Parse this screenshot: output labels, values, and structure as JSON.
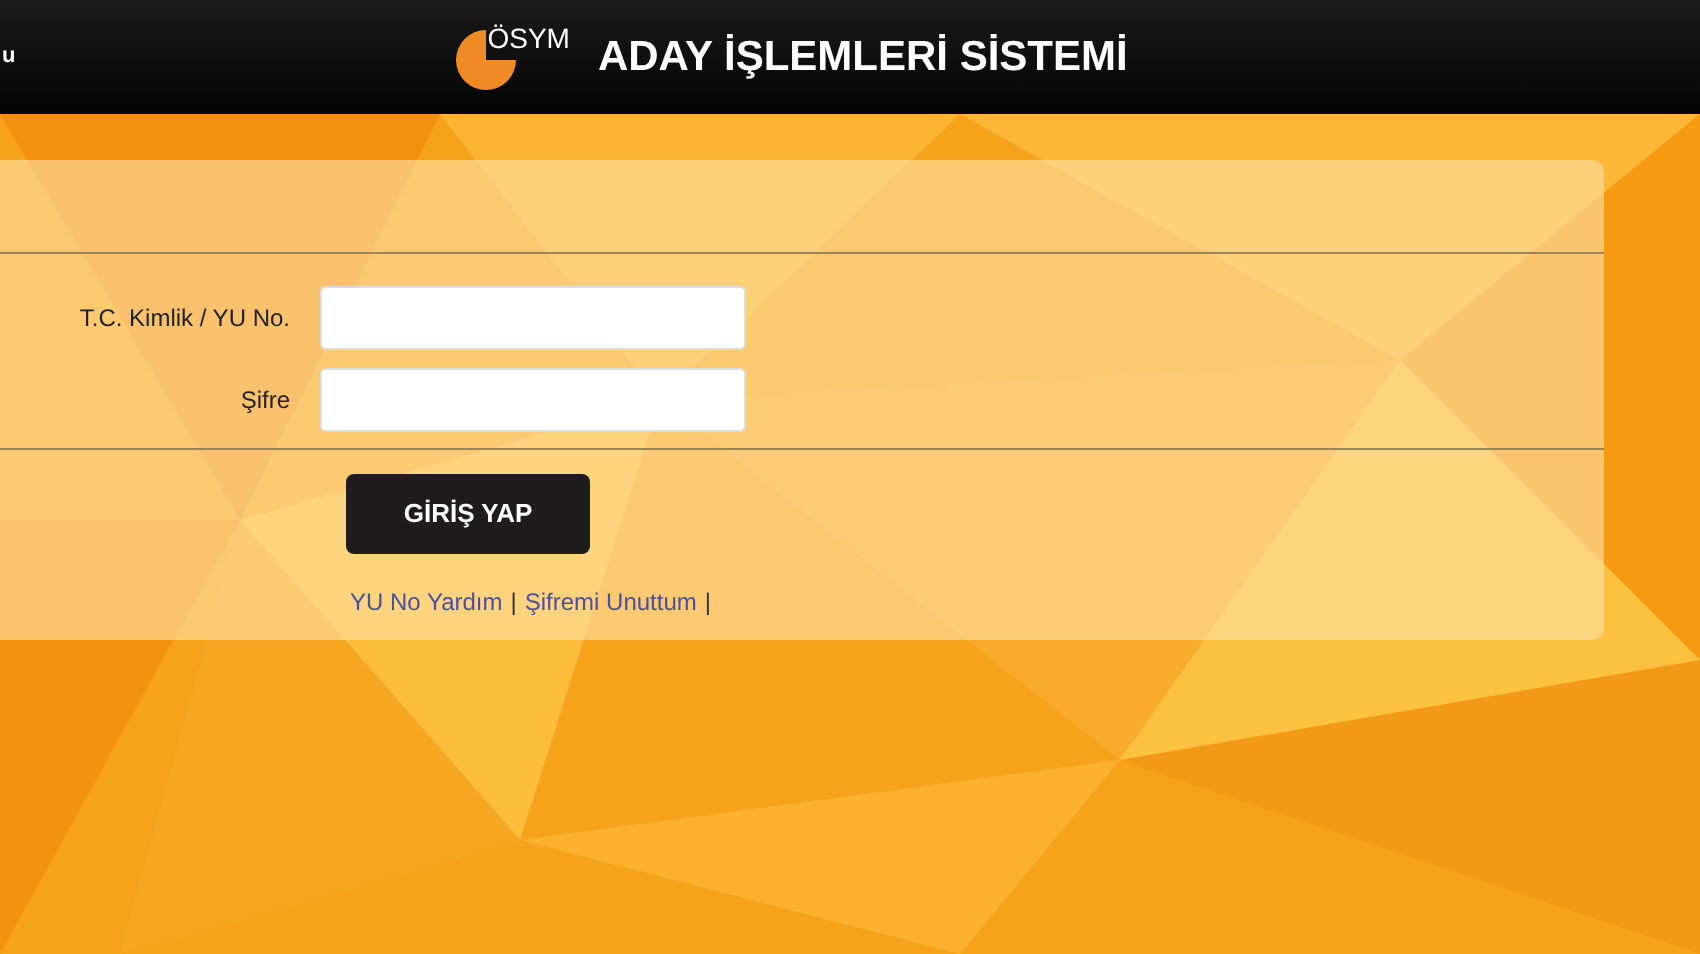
{
  "header": {
    "left_text": "u",
    "logo_text": "ÖSYM",
    "title": "ADAY İŞLEMLERİ SİSTEMİ"
  },
  "form": {
    "fields": [
      {
        "label": "T.C. Kimlik / YU No."
      },
      {
        "label": "Şifre"
      }
    ],
    "submit": "GİRİŞ YAP",
    "links": [
      {
        "label": "YU No Yardım",
        "separator": "|"
      },
      {
        "label": "Şifremi Unuttum",
        "separator": "|"
      }
    ]
  }
}
